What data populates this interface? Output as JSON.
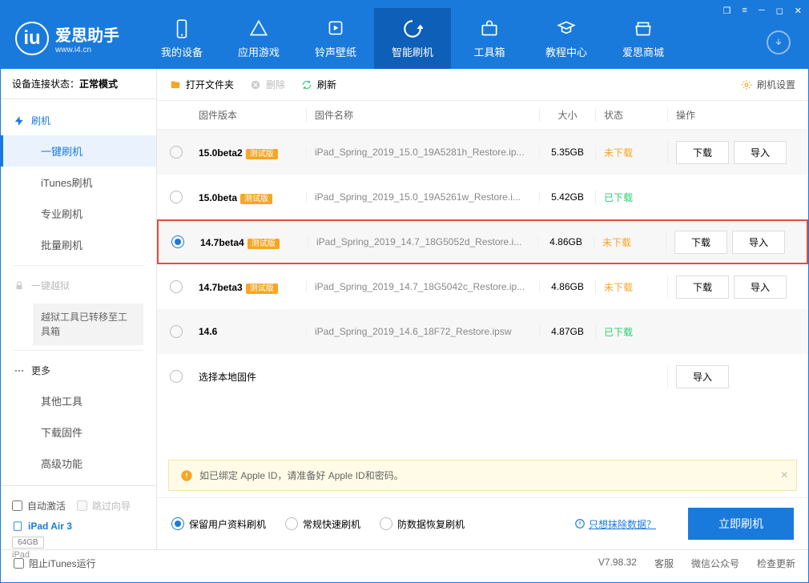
{
  "window_buttons": [
    "❐",
    "≡",
    "─",
    "◻",
    "✕"
  ],
  "brand": {
    "title": "爱思助手",
    "url": "www.i4.cn"
  },
  "nav": [
    {
      "label": "我的设备"
    },
    {
      "label": "应用游戏"
    },
    {
      "label": "铃声壁纸"
    },
    {
      "label": "智能刷机"
    },
    {
      "label": "工具箱"
    },
    {
      "label": "教程中心"
    },
    {
      "label": "爱思商城"
    }
  ],
  "status_label": "设备连接状态：",
  "status_value": "正常模式",
  "sidebar": {
    "flash_head": "刷机",
    "flash_items": [
      "一键刷机",
      "iTunes刷机",
      "专业刷机",
      "批量刷机"
    ],
    "jb_head": "一键越狱",
    "jb_note": "越狱工具已转移至工具箱",
    "more_head": "更多",
    "more_items": [
      "其他工具",
      "下载固件",
      "高级功能"
    ]
  },
  "device_panel": {
    "auto_activate": "自动激活",
    "skip_guide": "跳过向导",
    "name": "iPad Air 3",
    "storage": "64GB",
    "type": "iPad"
  },
  "toolbar": {
    "open": "打开文件夹",
    "delete": "删除",
    "refresh": "刷新",
    "settings": "刷机设置"
  },
  "columns": {
    "version": "固件版本",
    "name": "固件名称",
    "size": "大小",
    "status": "状态",
    "action": "操作"
  },
  "badge": "测试版",
  "rows": [
    {
      "ver": "15.0beta2",
      "badge": true,
      "name": "iPad_Spring_2019_15.0_19A5281h_Restore.ip...",
      "size": "5.35GB",
      "status": "未下载",
      "dl": true,
      "imp": true
    },
    {
      "ver": "15.0beta",
      "badge": true,
      "name": "iPad_Spring_2019_15.0_19A5261w_Restore.i...",
      "size": "5.42GB",
      "status": "已下载",
      "dl": false,
      "imp": false
    },
    {
      "ver": "14.7beta4",
      "badge": true,
      "name": "iPad_Spring_2019_14.7_18G5052d_Restore.i...",
      "size": "4.86GB",
      "status": "未下载",
      "dl": true,
      "imp": true,
      "selected": true,
      "highlight": true
    },
    {
      "ver": "14.7beta3",
      "badge": true,
      "name": "iPad_Spring_2019_14.7_18G5042c_Restore.ip...",
      "size": "4.86GB",
      "status": "未下载",
      "dl": true,
      "imp": true
    },
    {
      "ver": "14.6",
      "badge": false,
      "name": "iPad_Spring_2019_14.6_18F72_Restore.ipsw",
      "size": "4.87GB",
      "status": "已下载",
      "dl": false,
      "imp": false
    }
  ],
  "local_row": "选择本地固件",
  "buttons": {
    "download": "下载",
    "import": "导入"
  },
  "warn": "如已绑定 Apple ID，请准备好 Apple ID和密码。",
  "modes": {
    "keep": "保留用户资料刷机",
    "normal": "常规快速刷机",
    "antiloss": "防数据恢复刷机"
  },
  "erase_link": "只想抹除数据？",
  "flash_now": "立即刷机",
  "footer": {
    "block_itunes": "阻止iTunes运行",
    "version": "V7.98.32",
    "service": "客服",
    "wechat": "微信公众号",
    "update": "检查更新"
  }
}
